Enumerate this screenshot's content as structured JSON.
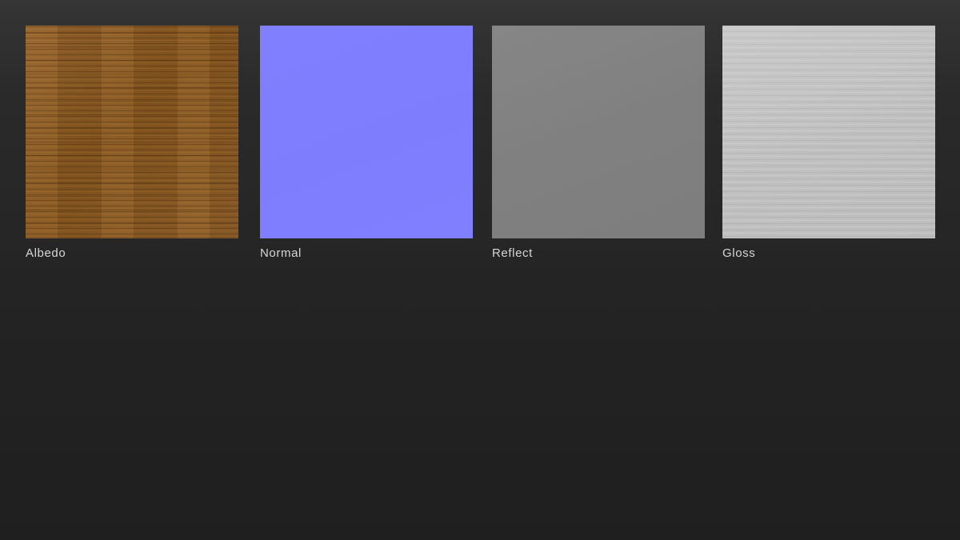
{
  "texture_maps": [
    {
      "label": "Albedo",
      "base_color": "#8a5a26",
      "pattern": "wood-grain"
    },
    {
      "label": "Normal",
      "base_color": "#8080ff",
      "pattern": "flat"
    },
    {
      "label": "Reflect",
      "base_color": "#808080",
      "pattern": "flat"
    },
    {
      "label": "Gloss",
      "base_color": "#c4c4c4",
      "pattern": "brushed"
    }
  ],
  "theme": {
    "background_top": "#353535",
    "background_bottom": "#1f1f1f",
    "label_color": "#d6d6d6"
  }
}
